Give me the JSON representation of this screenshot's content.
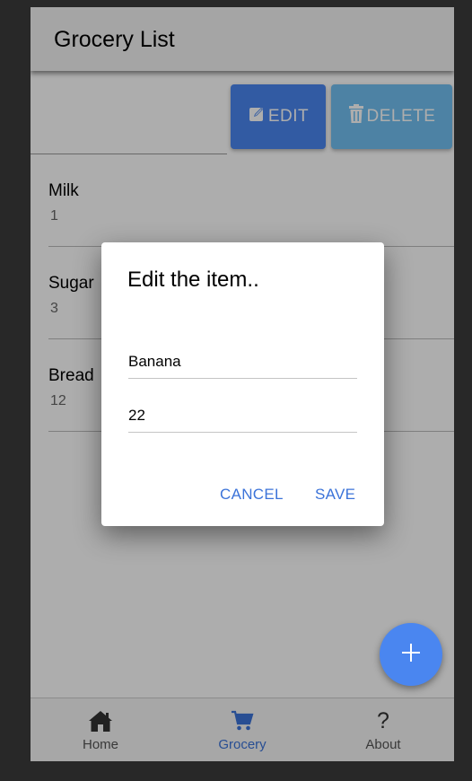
{
  "appbar": {
    "title": "Grocery List"
  },
  "toolbar": {
    "edit_label": "EDIT",
    "delete_label": "DELETE"
  },
  "items": [
    {
      "name": "Milk",
      "quantity": "1"
    },
    {
      "name": "Sugar",
      "quantity": "3"
    },
    {
      "name": "Bread",
      "quantity": "12"
    }
  ],
  "dialog": {
    "title": "Edit the item..",
    "name_value": "Banana",
    "quantity_value": "22",
    "cancel_label": "CANCEL",
    "save_label": "SAVE"
  },
  "fab": {
    "icon": "plus-icon"
  },
  "nav": {
    "items": [
      {
        "label": "Home",
        "icon": "home-icon",
        "active": false
      },
      {
        "label": "Grocery",
        "icon": "cart-icon",
        "active": true
      },
      {
        "label": "About",
        "icon": "question-icon",
        "active": false
      }
    ]
  },
  "colors": {
    "primary": "#4a86f0",
    "delete": "#72c0f2",
    "active_nav": "#3b73d9"
  }
}
